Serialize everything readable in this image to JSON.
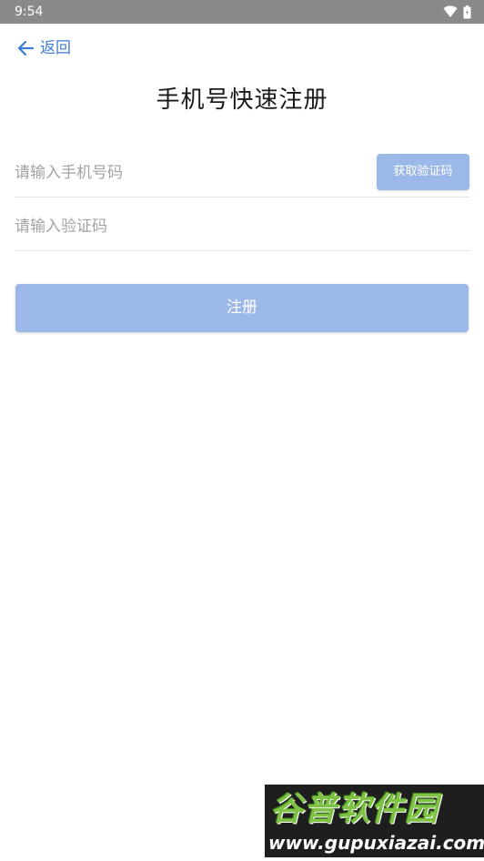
{
  "status_bar": {
    "time": "9:54",
    "icons": [
      "wifi-icon",
      "battery-icon"
    ]
  },
  "nav": {
    "back_label": "返回",
    "back_icon": "arrow-left-icon"
  },
  "page": {
    "title": "手机号快速注册"
  },
  "form": {
    "phone_placeholder": "请输入手机号码",
    "phone_value": "",
    "get_code_label": "获取验证码",
    "code_placeholder": "请输入验证码",
    "code_value": "",
    "register_label": "注册"
  },
  "watermark": {
    "brand": "谷普软件园",
    "url": "www.gupuxiazai.com"
  },
  "colors": {
    "accent": "#3f7bd6",
    "button_disabled": "#9cb8e8",
    "status_bar": "#8a8a8a"
  }
}
